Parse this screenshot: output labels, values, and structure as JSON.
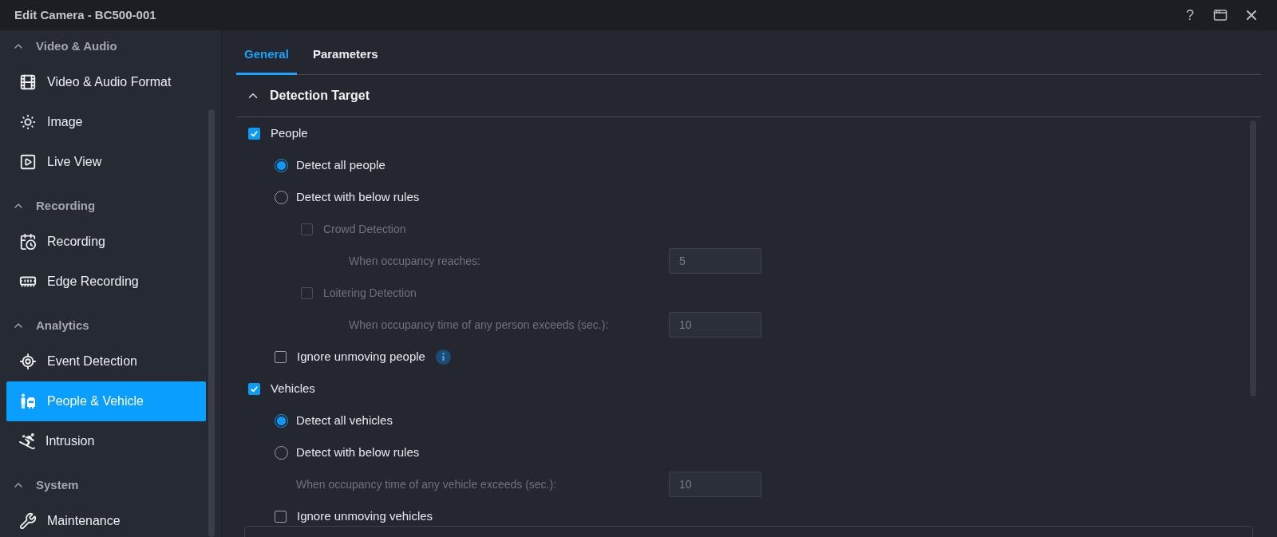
{
  "window": {
    "title": "Edit Camera - BC500-001",
    "help": "?"
  },
  "sidebar": {
    "groups": [
      {
        "title": "Video & Audio",
        "expanded": true,
        "items": [
          {
            "label": "Video & Audio Format",
            "selected": false
          },
          {
            "label": "Image",
            "selected": false
          },
          {
            "label": "Live View",
            "selected": false
          }
        ]
      },
      {
        "title": "Recording",
        "expanded": true,
        "items": [
          {
            "label": "Recording",
            "selected": false
          },
          {
            "label": "Edge Recording",
            "selected": false
          }
        ]
      },
      {
        "title": "Analytics",
        "expanded": true,
        "items": [
          {
            "label": "Event Detection",
            "selected": false
          },
          {
            "label": "People & Vehicle",
            "selected": true
          },
          {
            "label": "Intrusion",
            "selected": false
          }
        ]
      },
      {
        "title": "System",
        "expanded": true,
        "items": [
          {
            "label": "Maintenance",
            "selected": false
          }
        ]
      }
    ]
  },
  "tabs": [
    {
      "label": "General",
      "selected": true
    },
    {
      "label": "Parameters",
      "selected": false
    }
  ],
  "section": {
    "title": "Detection Target",
    "expanded": true
  },
  "targets": [
    {
      "label": "People",
      "checked": true,
      "options": [
        {
          "label": "Detect all people",
          "selected": true
        },
        {
          "label": "Detect with below rules",
          "selected": false
        }
      ],
      "rules": [
        {
          "kind": "checkbox",
          "label": "Crowd Detection",
          "checked": false,
          "disabled": true,
          "children": [
            {
              "kind": "field",
              "label": "When occupancy reaches:",
              "value": "5",
              "disabled": true
            }
          ]
        },
        {
          "kind": "checkbox",
          "label": "Loitering Detection",
          "checked": false,
          "disabled": true,
          "children": [
            {
              "kind": "field",
              "label": "When occupancy time of any person exceeds (sec.):",
              "value": "10",
              "disabled": true
            }
          ]
        }
      ],
      "ignore": {
        "label": "Ignore unmoving people",
        "checked": false,
        "info": true
      }
    },
    {
      "label": "Vehicles",
      "checked": true,
      "options": [
        {
          "label": "Detect all vehicles",
          "selected": true
        },
        {
          "label": "Detect with below rules",
          "selected": false
        }
      ],
      "rules": [
        {
          "kind": "field",
          "label": "When occupancy time of any vehicle exceeds (sec.):",
          "value": "10",
          "disabled": true
        }
      ],
      "ignore": {
        "label": "Ignore unmoving vehicles",
        "checked": false
      }
    }
  ]
}
